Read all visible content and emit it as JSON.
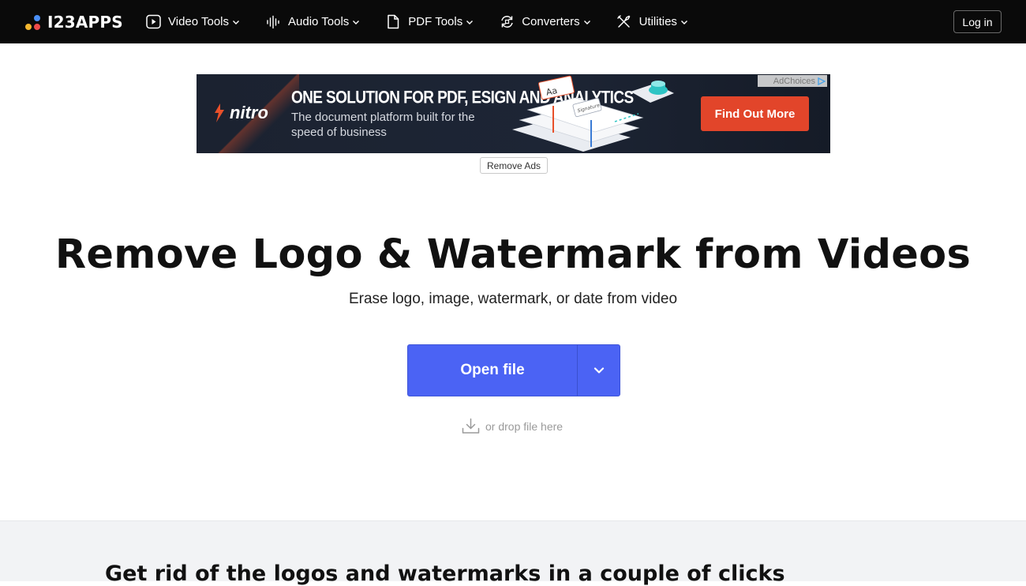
{
  "brand": {
    "name": "I23APPS"
  },
  "nav": {
    "items": [
      {
        "label": "Video Tools",
        "icon": "play-icon"
      },
      {
        "label": "Audio Tools",
        "icon": "audio-wave-icon"
      },
      {
        "label": "PDF Tools",
        "icon": "document-icon"
      },
      {
        "label": "Converters",
        "icon": "convert-icon"
      },
      {
        "label": "Utilities",
        "icon": "tools-icon"
      }
    ],
    "login_label": "Log in"
  },
  "ad": {
    "brand": "nitro",
    "headline": "ONE SOLUTION FOR PDF, ESIGN AND ANALYTICS",
    "subtext": "The document platform built for the speed of business",
    "cta": "Find Out More",
    "adchoices": "AdChoices",
    "art_labels": [
      "Aa",
      "Signature"
    ]
  },
  "remove_ads_label": "Remove Ads",
  "hero": {
    "title": "Remove Logo & Watermark from Videos",
    "subtitle": "Erase logo, image, watermark, or date from video",
    "open_file_label": "Open file",
    "drop_hint": "or drop file here"
  },
  "section": {
    "title": "Get rid of the logos and watermarks in a couple of clicks"
  },
  "colors": {
    "topbar": "#0a0a0a",
    "primary_button": "#4b63f4",
    "ad_cta": "#e2452a",
    "section_bg": "#f2f3f5"
  }
}
